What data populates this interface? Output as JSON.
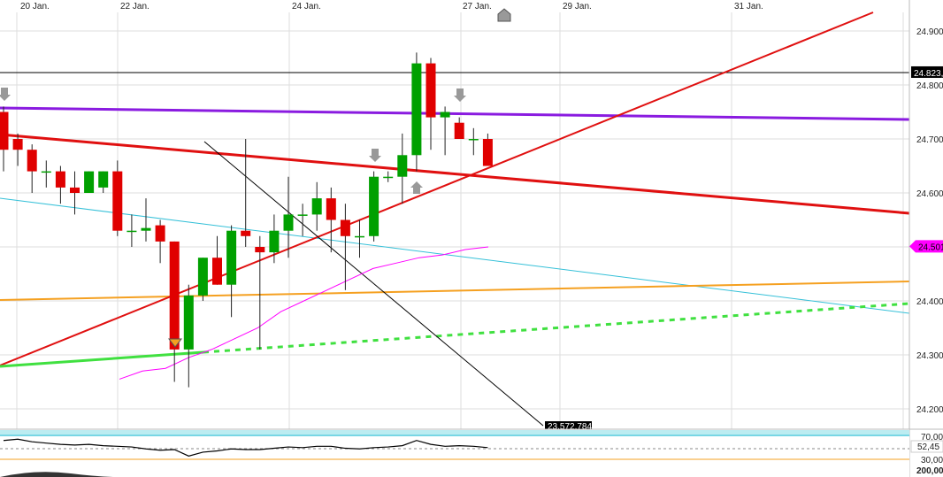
{
  "chart_data": {
    "type": "candlestick",
    "x": [
      "20 Jan.",
      "22 Jan.",
      "24 Jan.",
      "27 Jan.",
      "29 Jan.",
      "31 Jan."
    ],
    "ylim": [
      24160,
      24940
    ],
    "y_ticks": [
      "24.900",
      "24.800",
      "24.700",
      "24.600",
      "24.500",
      "24.400",
      "24.300",
      "24.200"
    ],
    "y_tick_values": [
      24900,
      24800,
      24700,
      24600,
      24500,
      24400,
      24300,
      24200
    ],
    "price_labels": [
      {
        "text": "24.823,",
        "value": 24823,
        "color": "#000000"
      },
      {
        "text": "24.501",
        "value": 24501,
        "color": "#ff00ff"
      }
    ],
    "crosshair_value": 24823,
    "line_end_label": "23.572,784",
    "candles": [
      {
        "o": 24750,
        "h": 24760,
        "l": 24640,
        "c": 24680
      },
      {
        "o": 24700,
        "h": 24710,
        "l": 24650,
        "c": 24680
      },
      {
        "o": 24680,
        "h": 24690,
        "l": 24600,
        "c": 24640
      },
      {
        "o": 24640,
        "h": 24660,
        "l": 24610,
        "c": 24640
      },
      {
        "o": 24640,
        "h": 24650,
        "l": 24580,
        "c": 24610
      },
      {
        "o": 24610,
        "h": 24640,
        "l": 24560,
        "c": 24600
      },
      {
        "o": 24600,
        "h": 24640,
        "l": 24600,
        "c": 24640
      },
      {
        "o": 24610,
        "h": 24640,
        "l": 24600,
        "c": 24640
      },
      {
        "o": 24640,
        "h": 24660,
        "l": 24520,
        "c": 24530
      },
      {
        "o": 24530,
        "h": 24560,
        "l": 24500,
        "c": 24530
      },
      {
        "o": 24530,
        "h": 24590,
        "l": 24510,
        "c": 24535
      },
      {
        "o": 24540,
        "h": 24550,
        "l": 24470,
        "c": 24510
      },
      {
        "o": 24510,
        "h": 24510,
        "l": 24250,
        "c": 24310
      },
      {
        "o": 24310,
        "h": 24430,
        "l": 24240,
        "c": 24410
      },
      {
        "o": 24410,
        "h": 24480,
        "l": 24400,
        "c": 24480
      },
      {
        "o": 24480,
        "h": 24520,
        "l": 24430,
        "c": 24430
      },
      {
        "o": 24430,
        "h": 24540,
        "l": 24370,
        "c": 24530
      },
      {
        "o": 24530,
        "h": 24700,
        "l": 24500,
        "c": 24520
      },
      {
        "o": 24500,
        "h": 24520,
        "l": 24310,
        "c": 24490
      },
      {
        "o": 24490,
        "h": 24560,
        "l": 24470,
        "c": 24530
      },
      {
        "o": 24530,
        "h": 24630,
        "l": 24480,
        "c": 24560
      },
      {
        "o": 24560,
        "h": 24580,
        "l": 24520,
        "c": 24560
      },
      {
        "o": 24560,
        "h": 24620,
        "l": 24530,
        "c": 24590
      },
      {
        "o": 24590,
        "h": 24610,
        "l": 24490,
        "c": 24550
      },
      {
        "o": 24550,
        "h": 24580,
        "l": 24420,
        "c": 24520
      },
      {
        "o": 24520,
        "h": 24550,
        "l": 24480,
        "c": 24520
      },
      {
        "o": 24520,
        "h": 24640,
        "l": 24510,
        "c": 24630
      },
      {
        "o": 24630,
        "h": 24640,
        "l": 24620,
        "c": 24630
      },
      {
        "o": 24630,
        "h": 24710,
        "l": 24580,
        "c": 24670
      },
      {
        "o": 24670,
        "h": 24860,
        "l": 24640,
        "c": 24840
      },
      {
        "o": 24840,
        "h": 24850,
        "l": 24680,
        "c": 24740
      },
      {
        "o": 24740,
        "h": 24760,
        "l": 24670,
        "c": 24750
      },
      {
        "o": 24730,
        "h": 24740,
        "l": 24700,
        "c": 24700
      },
      {
        "o": 24700,
        "h": 24720,
        "l": 24670,
        "c": 24700
      },
      {
        "o": 24700,
        "h": 24710,
        "l": 24650,
        "c": 24650
      }
    ],
    "moving_average": [
      24255,
      24270,
      24275,
      24295,
      24310,
      24330,
      24350,
      24380,
      24400,
      24420,
      24440,
      24460,
      24470,
      24480,
      24485,
      24495,
      24500
    ],
    "up_color": "#00a000",
    "down_color": "#e00000"
  },
  "rsi_panel": {
    "labels": [
      "70,00",
      "52,45",
      "30,00",
      "200,00"
    ],
    "values": [
      64,
      66,
      62,
      60,
      58,
      57,
      58,
      56,
      55,
      54,
      51,
      49,
      50,
      40,
      46,
      48,
      51,
      50,
      50,
      52,
      54,
      53,
      55,
      55,
      52,
      51,
      53,
      54,
      56,
      64,
      58,
      55,
      56,
      55,
      53
    ],
    "band_color": "#8fe0e8"
  },
  "colors": {
    "purple": "#8a1be0",
    "red": "#e01010",
    "cyan": "#35c0d8",
    "orange": "#f5a020",
    "green": "#40e040",
    "magenta": "#ff00ff",
    "grid": "#dddddd"
  }
}
